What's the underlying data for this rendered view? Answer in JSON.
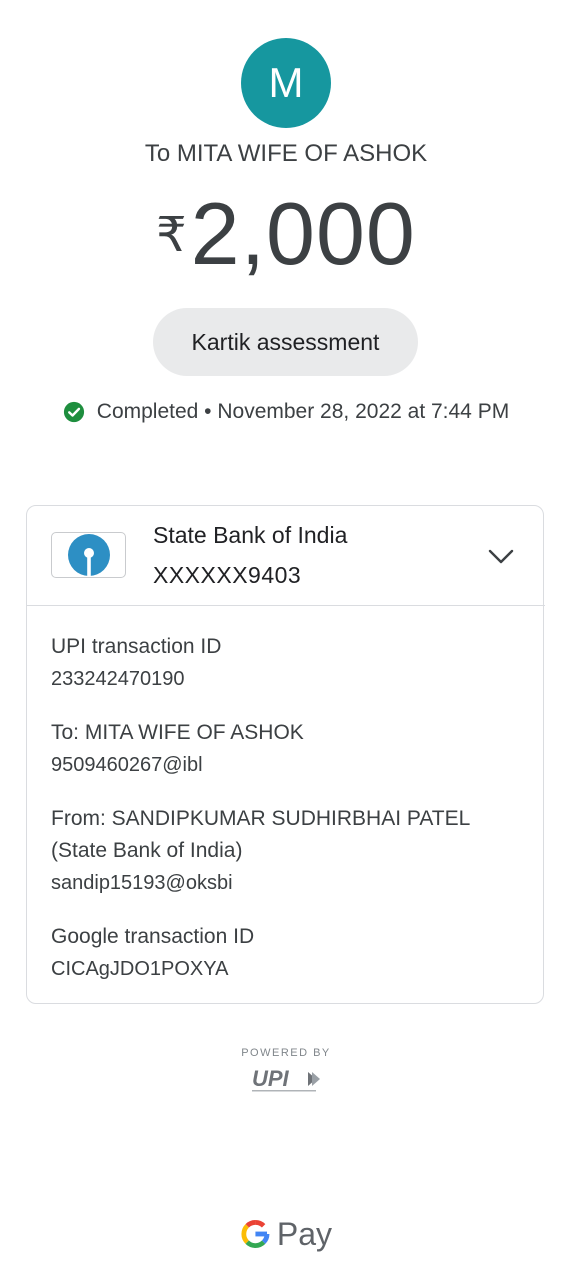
{
  "avatar": {
    "initial": "M",
    "color": "#16979f"
  },
  "recipient_title": "To MITA WIFE OF ASHOK",
  "amount": {
    "currency": "₹",
    "value": "2,000"
  },
  "note": "Kartik assessment",
  "status": {
    "icon": "check-circle-icon",
    "color": "#1e8e3e",
    "text": "Completed • November 28, 2022 at 7:44 PM"
  },
  "bank": {
    "name": "State Bank of India",
    "account": "XXXXXX9403",
    "logo_icon": "sbi-logo-icon",
    "logo_color": "#2d8fc4",
    "expand_icon": "chevron-down-icon"
  },
  "details": {
    "upi_label": "UPI transaction ID",
    "upi_value": "233242470190",
    "to_label": "To: MITA WIFE OF ASHOK",
    "to_value": "9509460267@ibl",
    "from_label_1": "From: SANDIPKUMAR SUDHIRBHAI PATEL",
    "from_label_2": "(State Bank of India)",
    "from_value": "sandip15193@oksbi",
    "google_label": "Google transaction ID",
    "google_value": "CICAgJDO1POXYA"
  },
  "footer": {
    "powered_by": "POWERED BY",
    "upi_logo": "UPI",
    "gpay_logo_icon": "google-g-icon",
    "gpay_text": "Pay"
  }
}
